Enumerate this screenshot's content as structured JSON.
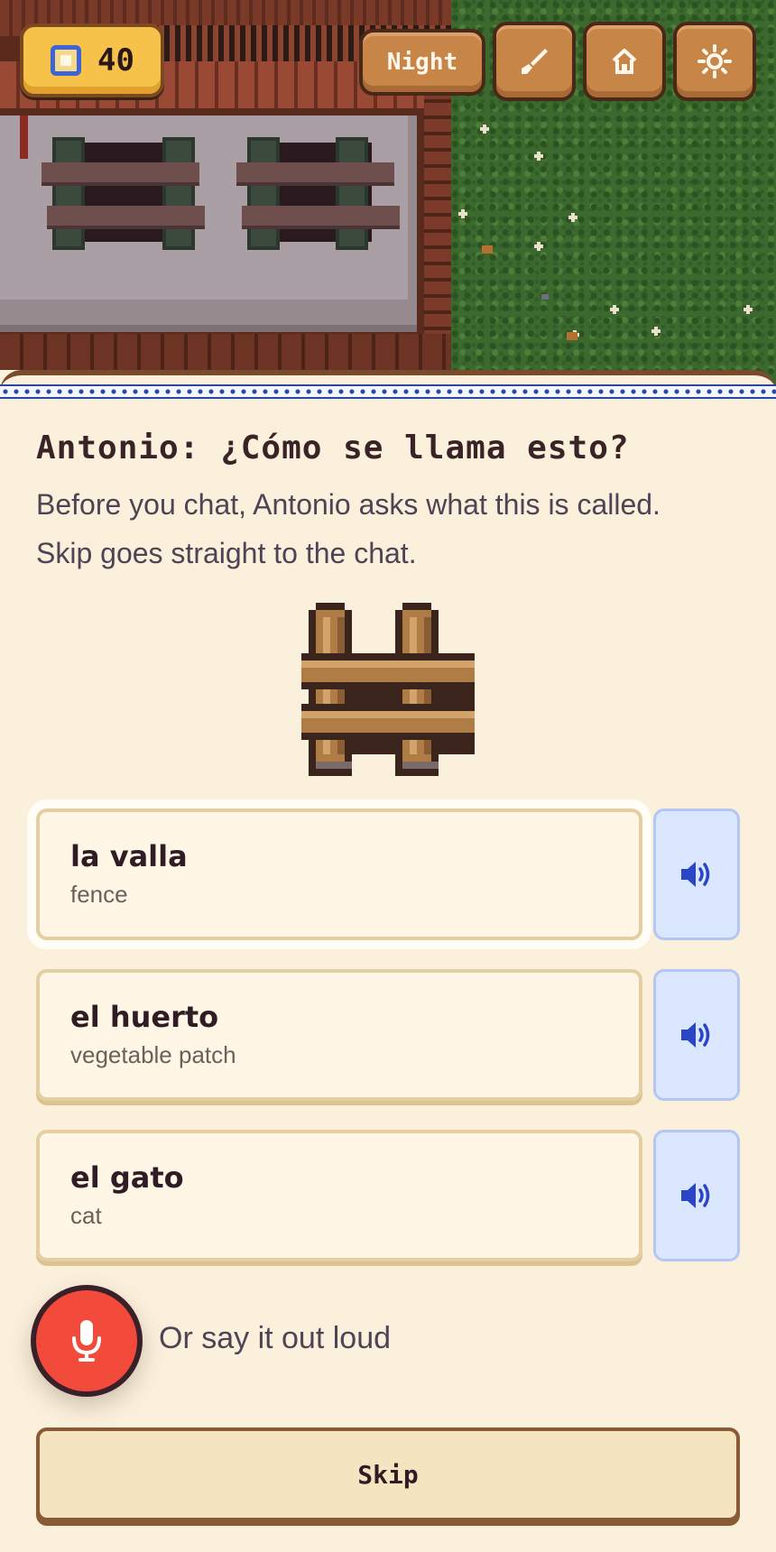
{
  "hud": {
    "coins": "40",
    "night_label": "Night",
    "icons": [
      "coin-icon",
      "brush-icon",
      "home-icon",
      "sun-icon"
    ]
  },
  "prompt": {
    "title": "Antonio: ¿Cómo se llama esto?",
    "subtitle": "Before you chat, Antonio asks what this is called. Skip goes straight to the chat."
  },
  "picture": "fence-icon",
  "options": [
    {
      "word": "la valla",
      "translation": "fence",
      "selected": true
    },
    {
      "word": "el huerto",
      "translation": "vegetable patch",
      "selected": false
    },
    {
      "word": "el gato",
      "translation": "cat",
      "selected": false
    }
  ],
  "voice": {
    "label": "Or say it out loud"
  },
  "skip": {
    "label": "Skip"
  },
  "colors": {
    "panel_bg": "#fbf0dc",
    "wood_button": "#c88548",
    "coin_badge": "#f6c24a",
    "audio_button": "#dbe6ff",
    "mic_button": "#f24b3c"
  }
}
